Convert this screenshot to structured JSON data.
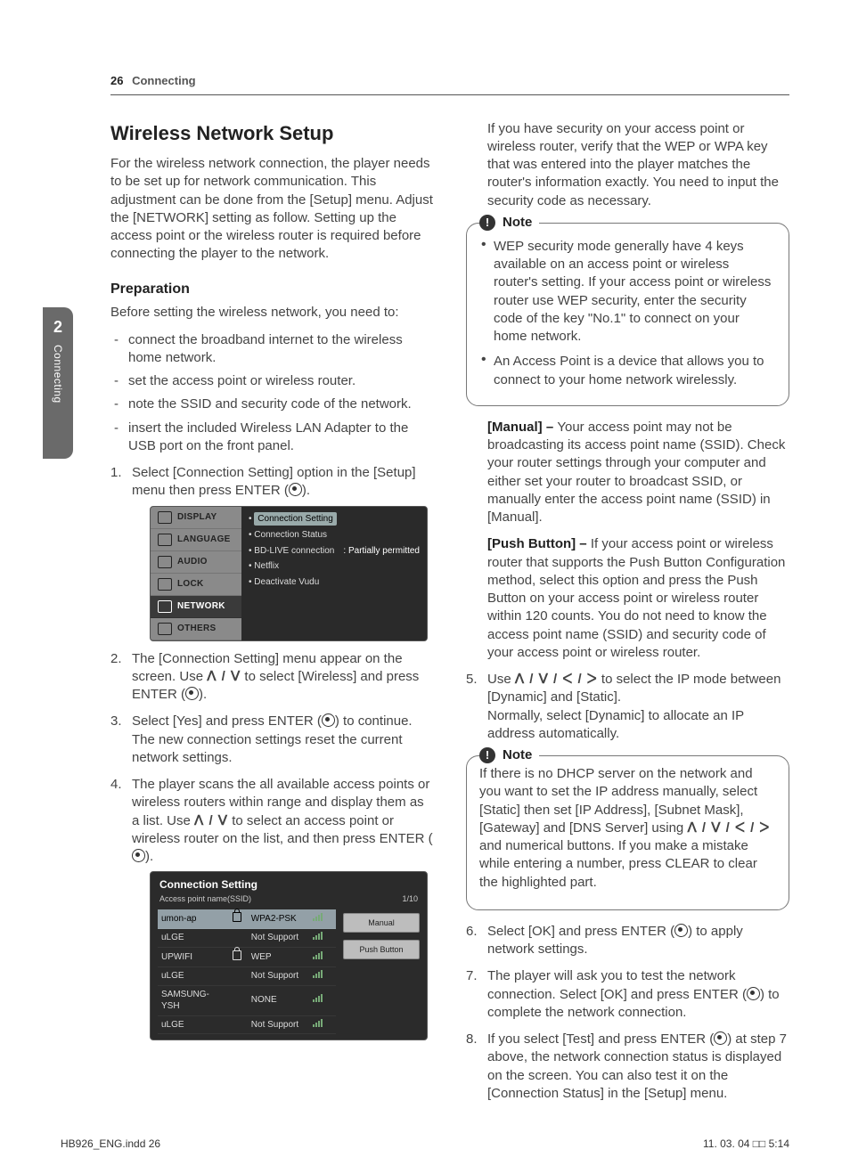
{
  "page": {
    "number": "26",
    "section": "Connecting"
  },
  "sidetab": {
    "number": "2",
    "label": "Connecting"
  },
  "h1": "Wireless Network Setup",
  "intro": "For the wireless network connection, the player needs to be set up for network communication. This adjustment can be done from the [Setup] menu. Adjust the [NETWORK] setting as follow. Setting up the access point or the wireless router is required before connecting the player to the network.",
  "prep": {
    "heading": "Preparation",
    "lead": "Before setting the wireless network, you need to:",
    "items": [
      "connect the broadband internet to the wireless home network.",
      "set the access point or wireless router.",
      "note the SSID and security code of the network.",
      "insert the included Wireless LAN Adapter to the USB port on the front panel."
    ]
  },
  "steps": {
    "s1": "Select [Connection Setting] option in the [Setup] menu then press ENTER (",
    "s1b": ").",
    "s2a": "The [Connection Setting] menu appear on the screen. Use ",
    "s2arrows": "ᐱ / ᐯ",
    "s2b": " to select [Wireless] and press ENTER (",
    "s2c": ").",
    "s3a": "Select [Yes] and press ENTER (",
    "s3b": ") to continue. The new connection settings reset the current network settings.",
    "s4a": "The player scans the all available access points or wireless routers within range and display them as a list. Use ",
    "s4arrows": "ᐱ / ᐯ",
    "s4b": " to select an access point or wireless router on the list, and then press ENTER (",
    "s4c": ").",
    "s5a": "Use ",
    "s5arrows": "ᐱ / ᐯ / ᐸ / ᐳ",
    "s5b": " to select the IP mode between [Dynamic] and [Static].",
    "s5c": "Normally, select [Dynamic] to allocate an IP address automatically.",
    "s6a": "Select [OK] and press ENTER (",
    "s6b": ") to apply network settings.",
    "s7a": "The player will ask you to test the network connection. Select [OK] and press ENTER (",
    "s7b": ") to complete the network connection.",
    "s8a": "If you select [Test] and press ENTER (",
    "s8b": ") at step 7 above, the network connection status is displayed on the screen. You can also test it on the [Connection Status] in the [Setup] menu."
  },
  "right_intro": "If you have security on your access point or wireless router, verify that the WEP or WPA key that was entered into the player matches the router's information exactly. You need to input the security code as necessary.",
  "note1": {
    "label": "Note",
    "items": [
      "WEP security mode generally have 4 keys available on an access point or wireless router's setting. If your access point or wireless router use WEP security, enter the security code of the key \"No.1\" to connect on your home network.",
      "An Access Point is a device that allows you to connect to your home network wirelessly."
    ]
  },
  "manual": {
    "label": "[Manual] – ",
    "text": "Your access point may not be broadcasting its access point name (SSID). Check your router settings through your computer and either set your router to broadcast SSID, or manually enter the access point name (SSID) in [Manual]."
  },
  "pushbtn": {
    "label": "[Push Button] – ",
    "text": "If your access point or wireless router that supports the Push Button Configuration method, select this option and press the Push Button on your access point or wireless router within 120 counts. You do not need to know the access point name (SSID) and security code of your access point or wireless router."
  },
  "note2": {
    "label": "Note",
    "text_a": "If there is no DHCP server on the network and you want to set the IP address manually, select [Static] then set [IP Address], [Subnet Mask], [Gateway] and [DNS Server] using ",
    "arrows": "ᐱ / ᐯ / ᐸ / ᐳ",
    "text_b": " and numerical buttons. If you make a mistake while entering a number, press CLEAR to clear the highlighted part."
  },
  "setup_menu": {
    "side": [
      "DISPLAY",
      "LANGUAGE",
      "AUDIO",
      "LOCK",
      "NETWORK",
      "OTHERS"
    ],
    "selected": "Connection Setting",
    "lines": [
      "Connection Status",
      "BD-LIVE connection",
      "Netflix",
      "Deactivate Vudu"
    ],
    "right_value": ": Partially permitted"
  },
  "conn_list": {
    "title": "Connection Setting",
    "subtitle": "Access point name(SSID)",
    "counter": "1/10",
    "rows": [
      {
        "ssid": "umon-ap",
        "lock": true,
        "sec": "WPA2-PSK",
        "sig": 3,
        "sel": true
      },
      {
        "ssid": "uLGE",
        "lock": false,
        "sec": "Not Support",
        "sig": 4,
        "sel": false
      },
      {
        "ssid": "UPWIFI",
        "lock": true,
        "sec": "WEP",
        "sig": 2,
        "sel": false
      },
      {
        "ssid": "uLGE",
        "lock": false,
        "sec": "Not Support",
        "sig": 3,
        "sel": false
      },
      {
        "ssid": "SAMSUNG-YSH",
        "lock": false,
        "sec": "NONE",
        "sig": 2,
        "sel": false
      },
      {
        "ssid": "uLGE",
        "lock": false,
        "sec": "Not Support",
        "sig": 2,
        "sel": false
      }
    ],
    "buttons": [
      "Manual",
      "Push Button"
    ]
  },
  "footer": {
    "left": "HB926_ENG.indd   26",
    "right": "11. 03. 04   □□ 5:14"
  }
}
